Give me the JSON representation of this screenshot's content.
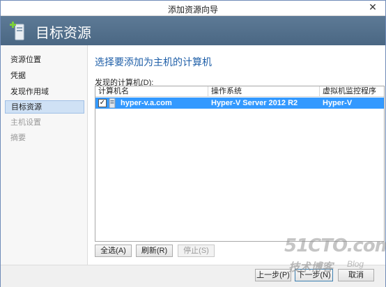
{
  "window": {
    "title": "添加资源向导",
    "close_glyph": "✕"
  },
  "header": {
    "title": "目标资源",
    "icon": "server-add-icon"
  },
  "sidebar": {
    "items": [
      {
        "label": "资源位置",
        "state": "normal"
      },
      {
        "label": "凭据",
        "state": "normal"
      },
      {
        "label": "发现作用域",
        "state": "normal"
      },
      {
        "label": "目标资源",
        "state": "active"
      },
      {
        "label": "主机设置",
        "state": "disabled"
      },
      {
        "label": "摘要",
        "state": "disabled"
      }
    ]
  },
  "main": {
    "section_title": "选择要添加为主机的计算机",
    "list_label": "发现的计算机(D):",
    "columns": [
      "计算机名",
      "操作系统",
      "虚拟机监控程序"
    ],
    "rows": [
      {
        "checked": true,
        "check_glyph": "✓",
        "name": "hyper-v.a.com",
        "os": "Hyper-V Server 2012 R2",
        "hypervisor": "Hyper-V"
      }
    ],
    "buttons": {
      "select_all": "全选(A)",
      "refresh": "刷新(R)",
      "stop": "停止(S)"
    }
  },
  "footer": {
    "prev": "上一步(P)",
    "next": "下一步(N)",
    "cancel": "取消"
  },
  "watermark": {
    "main": "51CTO.com",
    "sub": "技术博客",
    "blog": "Blog"
  },
  "colors": {
    "accent": "#1f5fa8",
    "header_bg": "#4f6c88",
    "selection": "#3399ff"
  }
}
